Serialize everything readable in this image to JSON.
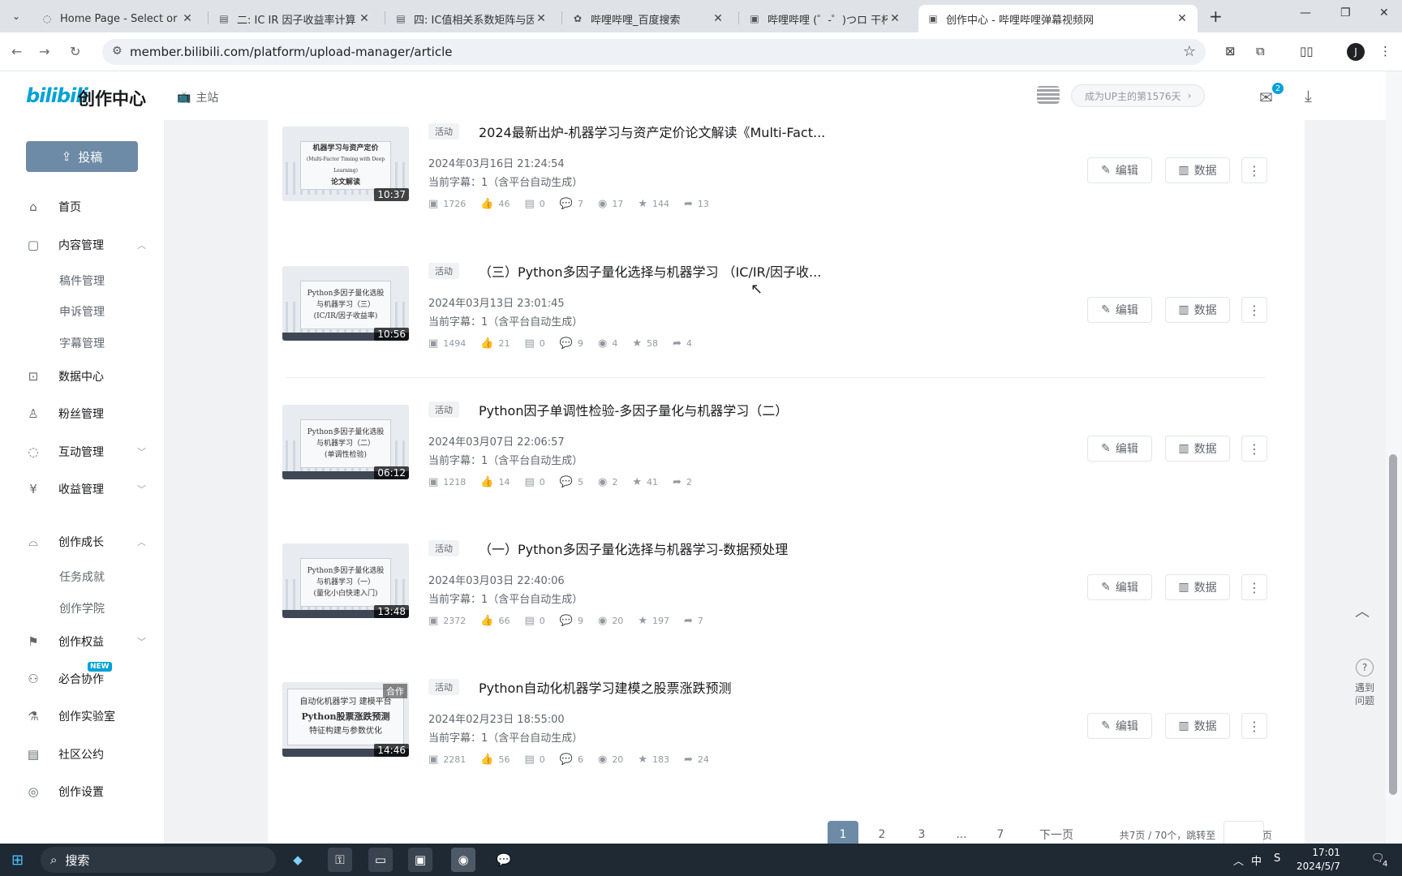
{
  "browser": {
    "tabs": [
      {
        "title": "Home Page - Select or creat",
        "icon": "globe-icon"
      },
      {
        "title": "二: IC IR 因子收益率计算 - J",
        "icon": "doc-icon"
      },
      {
        "title": "四: IC值相关系数矩阵与因子",
        "icon": "doc-icon"
      },
      {
        "title": "哔哩哔哩_百度搜索",
        "icon": "paw-icon"
      },
      {
        "title": "哔哩哔哩 (゜-゜)つロ 干杯~-b",
        "icon": "bili-icon"
      },
      {
        "title": "创作中心 - 哔哩哔哩弹幕视频网",
        "icon": "bili-icon"
      }
    ],
    "url": "member.bilibili.com/platform/upload-manager/article",
    "profile_initial": "J"
  },
  "header": {
    "logo": "bilibili",
    "logo_sub": "创作中心",
    "main_site": "主站",
    "up_days": "成为UP主的第1576天",
    "mail_badge": "2"
  },
  "sidebar": {
    "upload": "投稿",
    "items": [
      {
        "label": "首页",
        "icon": "home-icon"
      },
      {
        "label": "内容管理",
        "icon": "content-icon"
      },
      {
        "label": "稿件管理"
      },
      {
        "label": "申诉管理"
      },
      {
        "label": "字幕管理"
      },
      {
        "label": "数据中心",
        "icon": "chart-icon"
      },
      {
        "label": "粉丝管理",
        "icon": "user-icon"
      },
      {
        "label": "互动管理",
        "icon": "chat-icon"
      },
      {
        "label": "收益管理",
        "icon": "money-icon"
      },
      {
        "label": "创作成长",
        "icon": "cap-icon"
      },
      {
        "label": "任务成就"
      },
      {
        "label": "创作学院"
      },
      {
        "label": "创作权益",
        "icon": "flag-icon"
      },
      {
        "label": "必合协作",
        "icon": "people-icon"
      },
      {
        "label": "创作实验室",
        "icon": "flask-icon"
      },
      {
        "label": "社区公约",
        "icon": "book-icon"
      },
      {
        "label": "创作设置",
        "icon": "settings-icon"
      }
    ],
    "new_tag": "NEW"
  },
  "videos": [
    {
      "tag": "活动",
      "title": "2024最新出炉-机器学习与资产定价论文解读《Multi-Fact...",
      "date": "2024年03月16日 21:24:54",
      "subs": "当前字幕：1（含平台自动生成）",
      "duration": "10:37",
      "thumb": [
        "机器学习与资产定价",
        "(Multi-Factor Timing with Deep Learning)",
        "论文解读"
      ],
      "stats": [
        "1726",
        "46",
        "0",
        "7",
        "17",
        "144",
        "13"
      ]
    },
    {
      "tag": "活动",
      "title": "（三）Python多因子量化选择与机器学习 （IC/IR/因子收...",
      "date": "2024年03月13日 23:01:45",
      "subs": "当前字幕：1（含平台自动生成）",
      "duration": "10:56",
      "thumb": [
        "Python多因子量化选股",
        "与机器学习（三）",
        "(IC/IR/因子收益率)"
      ],
      "stats": [
        "1494",
        "21",
        "0",
        "9",
        "4",
        "58",
        "4"
      ]
    },
    {
      "tag": "活动",
      "title": "Python因子单调性检验-多因子量化与机器学习（二）",
      "date": "2024年03月07日 22:06:57",
      "subs": "当前字幕：1（含平台自动生成）",
      "duration": "06:12",
      "thumb": [
        "Python多因子量化选股",
        "与机器学习（二）",
        "(单调性检验)"
      ],
      "stats": [
        "1218",
        "14",
        "0",
        "5",
        "2",
        "41",
        "2"
      ]
    },
    {
      "tag": "活动",
      "title": "（一）Python多因子量化选择与机器学习-数据预处理",
      "date": "2024年03月03日 22:40:06",
      "subs": "当前字幕：1（含平台自动生成）",
      "duration": "13:48",
      "thumb": [
        "Python多因子量化选股",
        "与机器学习（一）",
        "(量化小白快速入门)"
      ],
      "stats": [
        "2372",
        "66",
        "0",
        "9",
        "20",
        "197",
        "7"
      ]
    },
    {
      "tag": "活动",
      "title": "Python自动化机器学习建模之股票涨跌预测",
      "date": "2024年02月23日 18:55:00",
      "subs": "当前字幕：1（含平台自动生成）",
      "duration": "14:46",
      "coop": "合作",
      "thumb": [
        "自动化机器学习 建模平台",
        "Python股票涨跌预测",
        "特征构建与参数优化"
      ],
      "stats": [
        "2281",
        "56",
        "0",
        "6",
        "20",
        "183",
        "24"
      ]
    }
  ],
  "actions": {
    "edit": "编辑",
    "data": "数据",
    "more": "⋮"
  },
  "pagination": {
    "pages": [
      "1",
      "2",
      "3",
      "...",
      "7"
    ],
    "next": "下一页",
    "summary": "共7页 / 70个，跳转至",
    "suffix": "页"
  },
  "float": {
    "help": "遇到\n问题"
  },
  "taskbar": {
    "search": "搜索",
    "ime": "中",
    "time": "17:01",
    "date": "2024/5/7",
    "notif": "4"
  }
}
